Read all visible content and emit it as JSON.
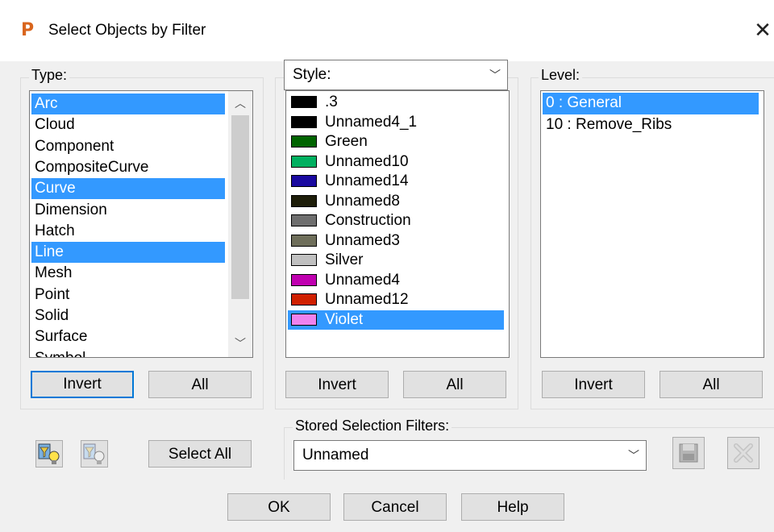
{
  "window": {
    "title": "Select Objects by Filter",
    "app_glyph": "P",
    "close_glyph": "✕"
  },
  "type_panel": {
    "label": "Type:",
    "items": [
      {
        "label": "Arc",
        "selected": true
      },
      {
        "label": "Cloud",
        "selected": false
      },
      {
        "label": "Component",
        "selected": false
      },
      {
        "label": "CompositeCurve",
        "selected": false
      },
      {
        "label": "Curve",
        "selected": true
      },
      {
        "label": "Dimension",
        "selected": false
      },
      {
        "label": "Hatch",
        "selected": false
      },
      {
        "label": "Line",
        "selected": true
      },
      {
        "label": "Mesh",
        "selected": false
      },
      {
        "label": "Point",
        "selected": false
      },
      {
        "label": "Solid",
        "selected": false
      },
      {
        "label": "Surface",
        "selected": false
      },
      {
        "label": "Symbol",
        "selected": false
      }
    ],
    "invert_label": "Invert",
    "all_label": "All"
  },
  "style_panel": {
    "label": "Style:",
    "items": [
      {
        "label": ".3",
        "color": "#000000",
        "selected": false
      },
      {
        "label": "Unnamed4_1",
        "color": "#000000",
        "selected": false
      },
      {
        "label": "Green",
        "color": "#006400",
        "selected": false
      },
      {
        "label": "Unnamed10",
        "color": "#00b060",
        "selected": false
      },
      {
        "label": "Unnamed14",
        "color": "#1a0aa0",
        "selected": false
      },
      {
        "label": "Unnamed8",
        "color": "#1e1e0a",
        "selected": false
      },
      {
        "label": "Construction",
        "color": "#6e6e6e",
        "selected": false
      },
      {
        "label": "Unnamed3",
        "color": "#6e6e5a",
        "selected": false
      },
      {
        "label": "Silver",
        "color": "#c0c0c0",
        "selected": false
      },
      {
        "label": "Unnamed4",
        "color": "#c000b0",
        "selected": false
      },
      {
        "label": "Unnamed12",
        "color": "#d02000",
        "selected": false
      },
      {
        "label": "Violet",
        "color": "#ee82ee",
        "selected": true
      }
    ],
    "invert_label": "Invert",
    "all_label": "All"
  },
  "level_panel": {
    "label": "Level:",
    "items": [
      {
        "label": "0  : General",
        "selected": true
      },
      {
        "label": "10  : Remove_Ribs",
        "selected": false
      }
    ],
    "invert_label": "Invert",
    "all_label": "All"
  },
  "bottom": {
    "select_all_label": "Select All",
    "stored_label": "Stored Selection Filters:",
    "stored_value": "Unnamed"
  },
  "footer": {
    "ok_label": "OK",
    "cancel_label": "Cancel",
    "help_label": "Help"
  }
}
